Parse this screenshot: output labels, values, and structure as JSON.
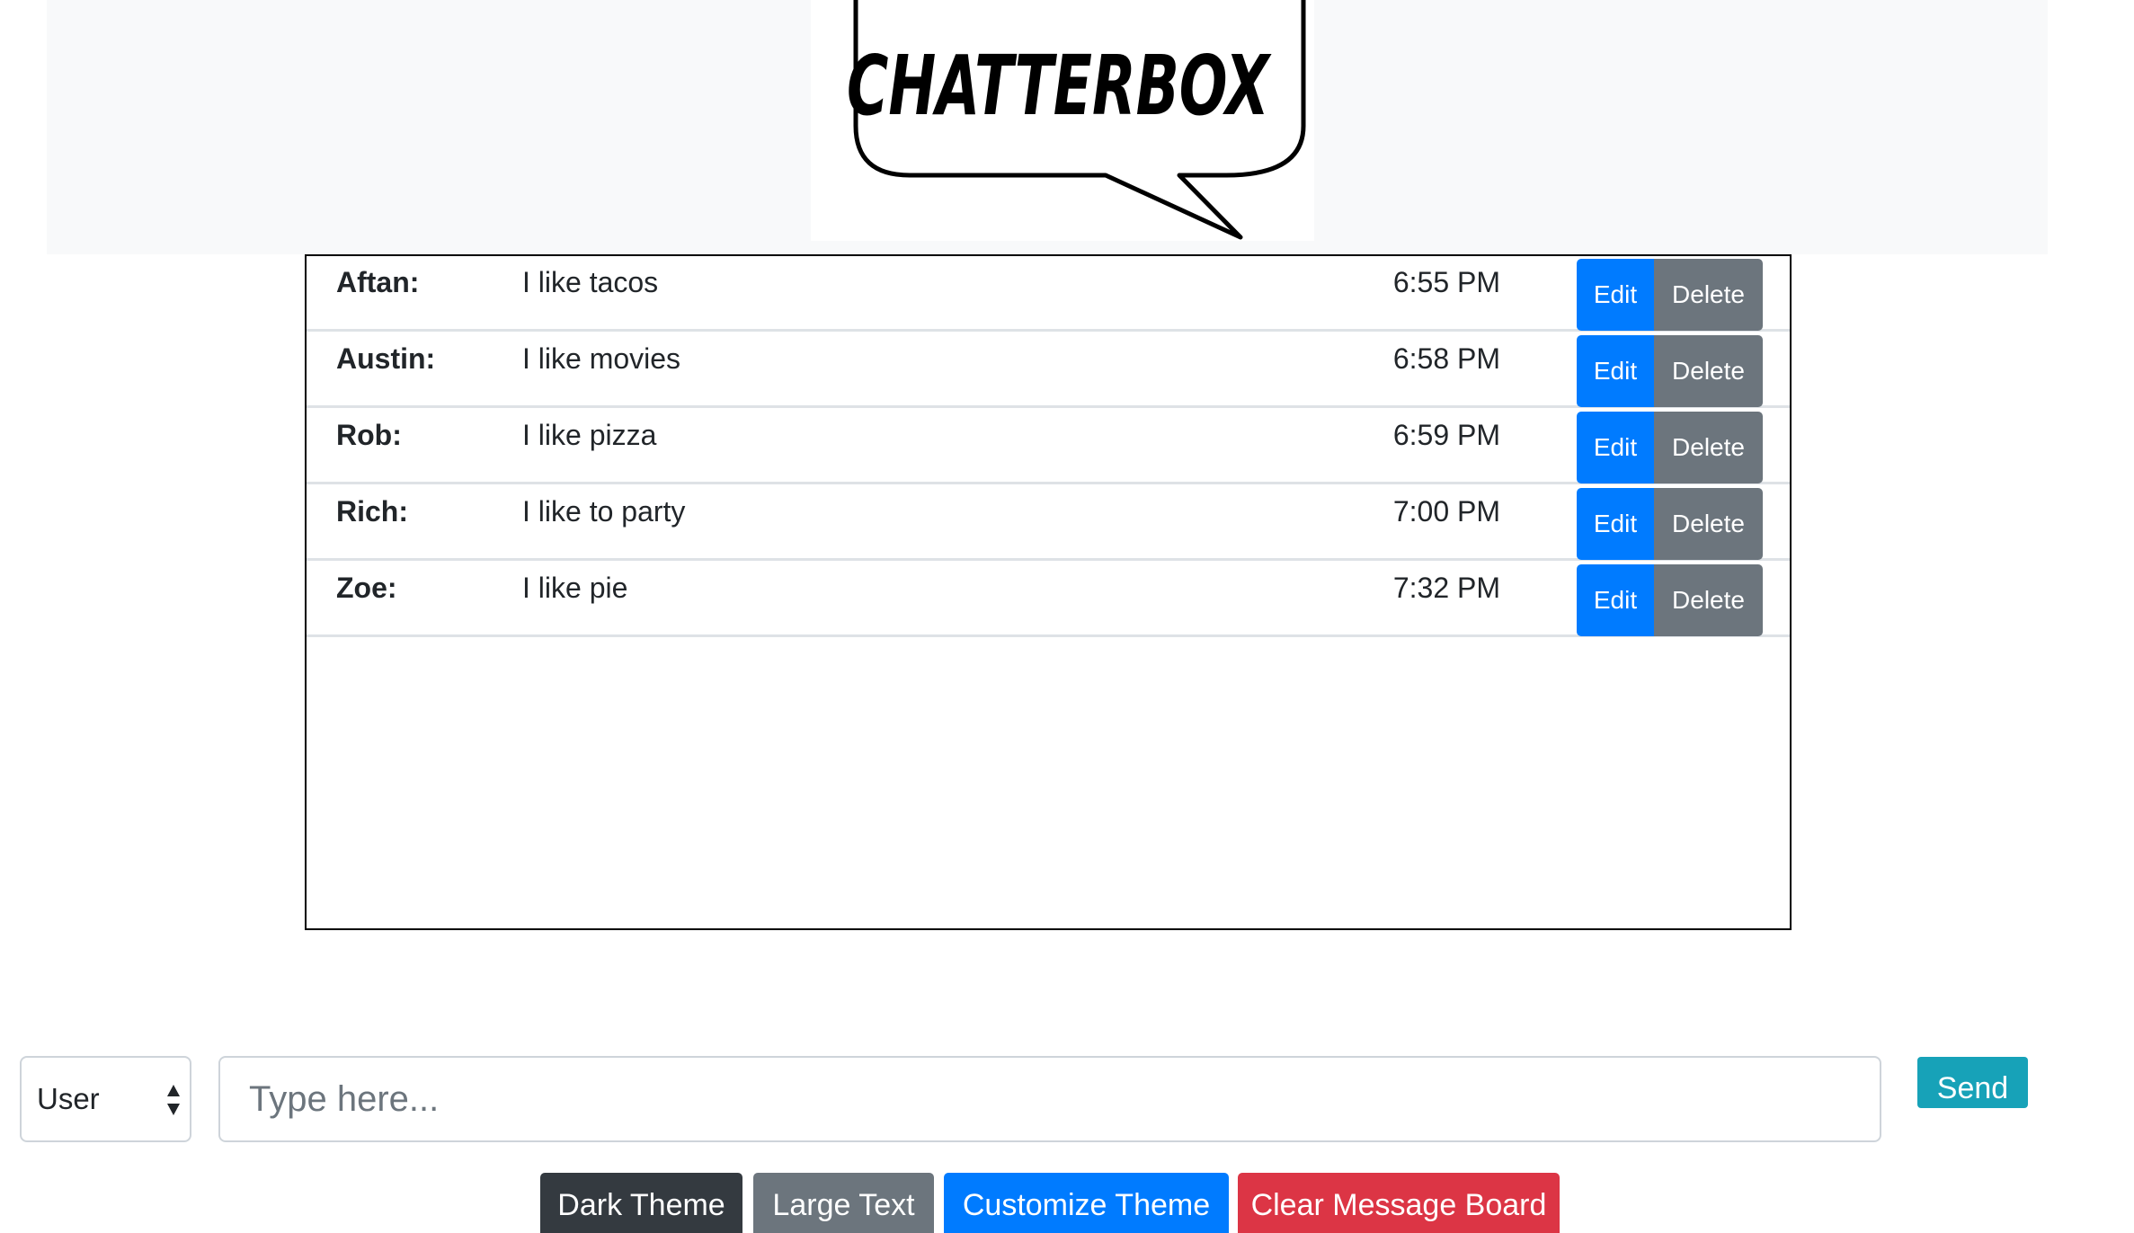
{
  "header": {
    "logo_text": "CHATTERBOX"
  },
  "messages": [
    {
      "user": "Aftan:",
      "text": "I like tacos",
      "time": "6:55 PM",
      "edit_label": "Edit",
      "delete_label": "Delete"
    },
    {
      "user": "Austin:",
      "text": "I like movies",
      "time": "6:58 PM",
      "edit_label": "Edit",
      "delete_label": "Delete"
    },
    {
      "user": "Rob:",
      "text": "I like pizza",
      "time": "6:59 PM",
      "edit_label": "Edit",
      "delete_label": "Delete"
    },
    {
      "user": "Rich:",
      "text": "I like to party",
      "time": "7:00 PM",
      "edit_label": "Edit",
      "delete_label": "Delete"
    },
    {
      "user": "Zoe:",
      "text": "I like pie",
      "time": "7:32 PM",
      "edit_label": "Edit",
      "delete_label": "Delete"
    }
  ],
  "composer": {
    "user_select_value": "User",
    "input_placeholder": "Type here...",
    "send_label": "Send"
  },
  "theme_buttons": {
    "dark": "Dark Theme",
    "large_text": "Large Text",
    "customize": "Customize Theme",
    "clear": "Clear Message Board"
  },
  "colors": {
    "header_band": "#f8f9fa",
    "primary": "#007bff",
    "secondary": "#6c757d",
    "dark": "#343a40",
    "info": "#17a2b8",
    "danger": "#dc3545"
  }
}
